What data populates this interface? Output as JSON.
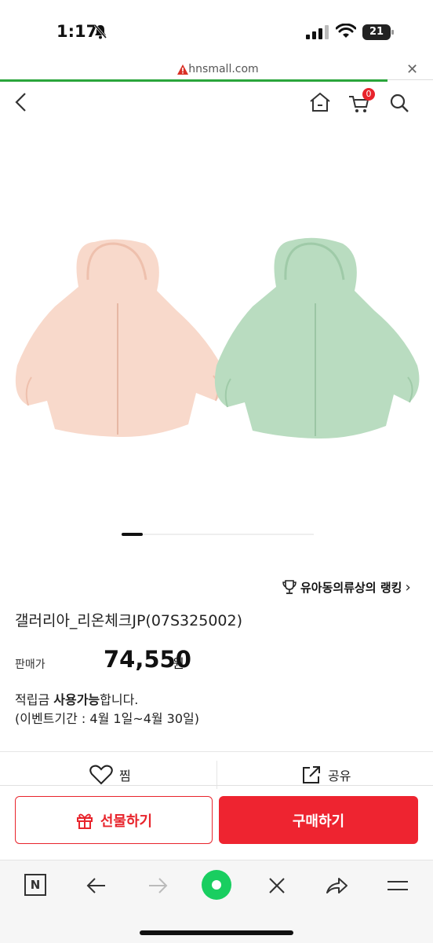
{
  "status_bar": {
    "time": "1:17",
    "battery": "21"
  },
  "browser": {
    "url": "hnsmall.com",
    "close_label": "✕"
  },
  "header": {
    "cart_count": "0"
  },
  "product": {
    "ranking_label": "유아동의류상의 랭킹",
    "ranking_chevron": "›",
    "title": "갤러리아_리온체크JP(07S325002)",
    "price_label": "판매가",
    "price": "74,550",
    "currency": "원",
    "points_prefix": "적립금 ",
    "points_bold": "사용가능",
    "points_suffix": "합니다.",
    "event_period": "(이벤트기간 : 4월 1일~4월 30일)",
    "image_colors": {
      "left_jacket": "#f8d9cb",
      "right_jacket": "#b9dcc0"
    }
  },
  "actions": {
    "wishlist_label": "찜",
    "share_label": "공유"
  },
  "cta": {
    "gift_label": "선물하기",
    "buy_label": "구매하기"
  },
  "toolbar": {
    "n_label": "N"
  },
  "colors": {
    "accent": "#ee2430",
    "progress": "#2aa53b"
  }
}
